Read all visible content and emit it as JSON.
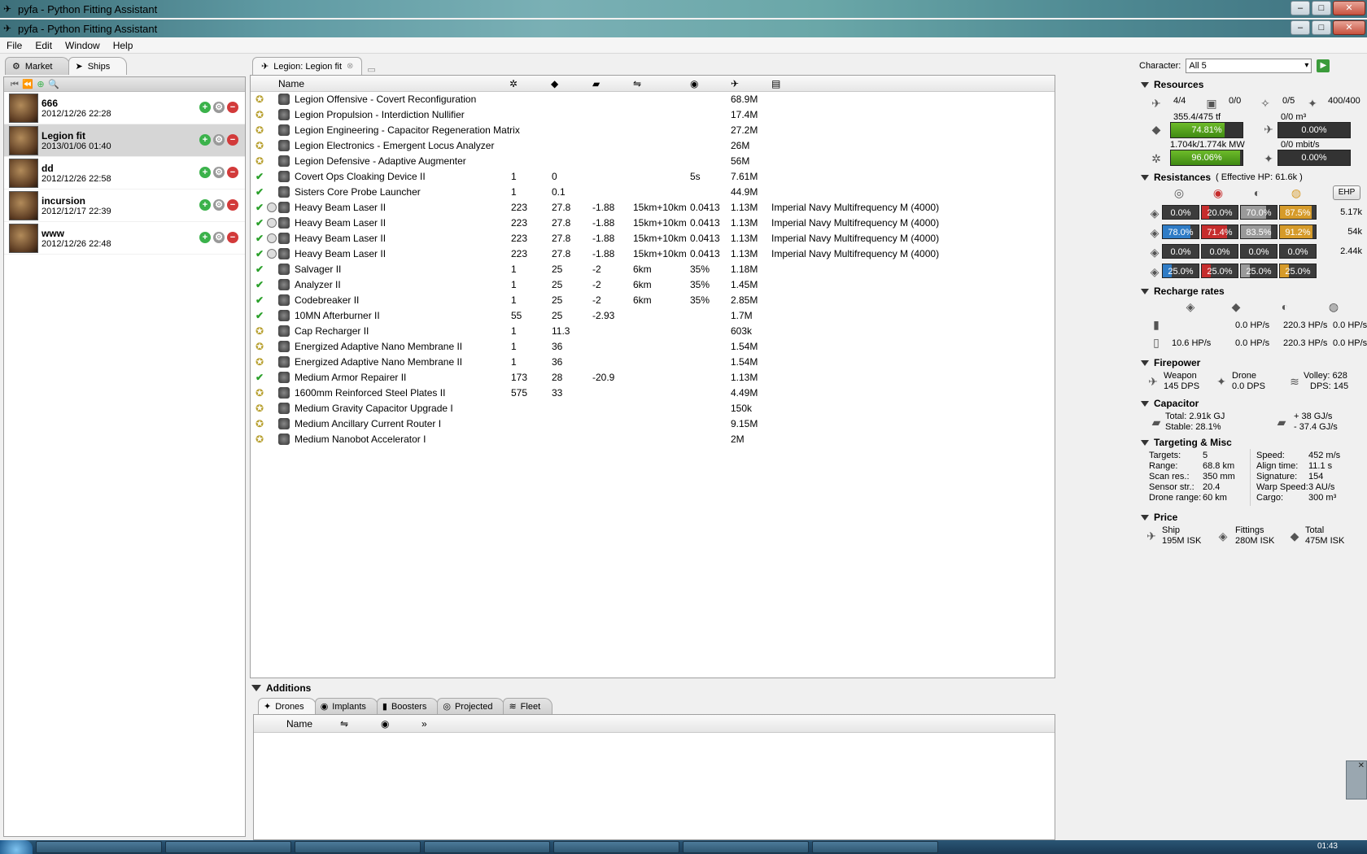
{
  "window": {
    "title": "pyfa - Python Fitting Assistant",
    "title2": "pyfa - Python Fitting Assistant"
  },
  "menu": {
    "file": "File",
    "edit": "Edit",
    "window": "Window",
    "help": "Help"
  },
  "left_tabs": {
    "market": "Market",
    "ships": "Ships"
  },
  "fits": [
    {
      "name": "666",
      "date": "2012/12/26 22:28"
    },
    {
      "name": "Legion fit",
      "date": "2013/01/06 01:40"
    },
    {
      "name": "dd",
      "date": "2012/12/26 22:58"
    },
    {
      "name": "incursion",
      "date": "2012/12/17 22:39"
    },
    {
      "name": "www",
      "date": "2012/12/26 22:48"
    }
  ],
  "center_tab": {
    "label": "Legion: Legion fit"
  },
  "fitting": {
    "name_header": "Name",
    "rows": [
      {
        "state": "off",
        "name": "Legion Offensive - Covert Reconfiguration",
        "c1": "",
        "c2": "",
        "c3": "",
        "c4": "",
        "c5": "",
        "price": "68.9M",
        "charge": ""
      },
      {
        "state": "off",
        "name": "Legion Propulsion - Interdiction Nullifier",
        "c1": "",
        "c2": "",
        "c3": "",
        "c4": "",
        "c5": "",
        "price": "17.4M",
        "charge": ""
      },
      {
        "state": "off",
        "name": "Legion Engineering - Capacitor Regeneration Matrix",
        "c1": "",
        "c2": "",
        "c3": "",
        "c4": "",
        "c5": "",
        "price": "27.2M",
        "charge": ""
      },
      {
        "state": "off",
        "name": "Legion Electronics - Emergent Locus Analyzer",
        "c1": "",
        "c2": "",
        "c3": "",
        "c4": "",
        "c5": "",
        "price": "26M",
        "charge": ""
      },
      {
        "state": "off",
        "name": "Legion Defensive - Adaptive Augmenter",
        "c1": "",
        "c2": "",
        "c3": "",
        "c4": "",
        "c5": "",
        "price": "56M",
        "charge": ""
      },
      {
        "state": "on",
        "name": "Covert Ops Cloaking Device II",
        "c1": "1",
        "c2": "0",
        "c3": "",
        "c4": "",
        "c5": "5s",
        "price": "7.61M",
        "charge": ""
      },
      {
        "state": "on",
        "name": "Sisters Core Probe Launcher",
        "c1": "1",
        "c2": "0.1",
        "c3": "",
        "c4": "",
        "c5": "",
        "price": "44.9M",
        "charge": ""
      },
      {
        "state": "on",
        "name": "Heavy Beam Laser II",
        "c1": "223",
        "c2": "27.8",
        "c3": "-1.88",
        "c4": "15km+10km",
        "c5": "0.0413",
        "price": "1.13M",
        "charge": "Imperial Navy Multifrequency M (4000)",
        "linked": true
      },
      {
        "state": "on",
        "name": "Heavy Beam Laser II",
        "c1": "223",
        "c2": "27.8",
        "c3": "-1.88",
        "c4": "15km+10km",
        "c5": "0.0413",
        "price": "1.13M",
        "charge": "Imperial Navy Multifrequency M (4000)",
        "linked": true
      },
      {
        "state": "on",
        "name": "Heavy Beam Laser II",
        "c1": "223",
        "c2": "27.8",
        "c3": "-1.88",
        "c4": "15km+10km",
        "c5": "0.0413",
        "price": "1.13M",
        "charge": "Imperial Navy Multifrequency M (4000)",
        "linked": true
      },
      {
        "state": "on",
        "name": "Heavy Beam Laser II",
        "c1": "223",
        "c2": "27.8",
        "c3": "-1.88",
        "c4": "15km+10km",
        "c5": "0.0413",
        "price": "1.13M",
        "charge": "Imperial Navy Multifrequency M (4000)",
        "linked": true
      },
      {
        "state": "on",
        "name": "Salvager II",
        "c1": "1",
        "c2": "25",
        "c3": "-2",
        "c4": "6km",
        "c5": "35%",
        "price": "1.18M",
        "charge": ""
      },
      {
        "state": "on",
        "name": "Analyzer II",
        "c1": "1",
        "c2": "25",
        "c3": "-2",
        "c4": "6km",
        "c5": "35%",
        "price": "1.45M",
        "charge": ""
      },
      {
        "state": "on",
        "name": "Codebreaker II",
        "c1": "1",
        "c2": "25",
        "c3": "-2",
        "c4": "6km",
        "c5": "35%",
        "price": "2.85M",
        "charge": ""
      },
      {
        "state": "on",
        "name": "10MN Afterburner II",
        "c1": "55",
        "c2": "25",
        "c3": "-2.93",
        "c4": "",
        "c5": "",
        "price": "1.7M",
        "charge": ""
      },
      {
        "state": "off",
        "name": "Cap Recharger II",
        "c1": "1",
        "c2": "11.3",
        "c3": "",
        "c4": "",
        "c5": "",
        "price": "603k",
        "charge": ""
      },
      {
        "state": "off",
        "name": "Energized Adaptive Nano Membrane II",
        "c1": "1",
        "c2": "36",
        "c3": "",
        "c4": "",
        "c5": "",
        "price": "1.54M",
        "charge": ""
      },
      {
        "state": "off",
        "name": "Energized Adaptive Nano Membrane II",
        "c1": "1",
        "c2": "36",
        "c3": "",
        "c4": "",
        "c5": "",
        "price": "1.54M",
        "charge": ""
      },
      {
        "state": "on",
        "name": "Medium Armor Repairer II",
        "c1": "173",
        "c2": "28",
        "c3": "-20.9",
        "c4": "",
        "c5": "",
        "price": "1.13M",
        "charge": ""
      },
      {
        "state": "off",
        "name": "1600mm Reinforced Steel Plates II",
        "c1": "575",
        "c2": "33",
        "c3": "",
        "c4": "",
        "c5": "",
        "price": "4.49M",
        "charge": ""
      },
      {
        "state": "off",
        "name": "Medium Gravity Capacitor Upgrade I",
        "c1": "",
        "c2": "",
        "c3": "",
        "c4": "",
        "c5": "",
        "price": "150k",
        "charge": ""
      },
      {
        "state": "off",
        "name": "Medium Ancillary Current Router I",
        "c1": "",
        "c2": "",
        "c3": "",
        "c4": "",
        "c5": "",
        "price": "9.15M",
        "charge": ""
      },
      {
        "state": "off",
        "name": "Medium Nanobot Accelerator I",
        "c1": "",
        "c2": "",
        "c3": "",
        "c4": "",
        "c5": "",
        "price": "2M",
        "charge": ""
      }
    ]
  },
  "additions": {
    "title": "Additions",
    "tabs": [
      "Drones",
      "Implants",
      "Boosters",
      "Projected",
      "Fleet"
    ],
    "name_header": "Name"
  },
  "character": {
    "label": "Character:",
    "value": "All 5"
  },
  "resources": {
    "title": "Resources",
    "turrets": "4/4",
    "launchers": "0/0",
    "calibration": "0/5",
    "drone_bay": "400/400",
    "cpu_text": "355.4/475 tf",
    "cpu_pct": "74.81%",
    "cpu_fill": 74.81,
    "drone_bay_text": "0/0 m³",
    "drone_pct": "0.00%",
    "power_text": "1.704k/1.774k MW",
    "power_pct": "96.06%",
    "power_fill": 96.06,
    "bandwidth_text": "0/0 mbit/s",
    "bandwidth_pct": "0.00%"
  },
  "resistances": {
    "title": "Resistances",
    "ehp": "( Effective HP: 61.6k )",
    "ehp_button": "EHP",
    "rows": [
      {
        "vals": [
          "0.0%",
          "20.0%",
          "70.0%",
          "87.5%"
        ],
        "fills": [
          0,
          20,
          70,
          87.5
        ],
        "hp": "5.17k"
      },
      {
        "vals": [
          "78.0%",
          "71.4%",
          "83.5%",
          "91.2%"
        ],
        "fills": [
          78,
          71.4,
          83.5,
          91.2
        ],
        "hp": "54k"
      },
      {
        "vals": [
          "0.0%",
          "0.0%",
          "0.0%",
          "0.0%"
        ],
        "fills": [
          0,
          0,
          0,
          0
        ],
        "hp": "2.44k"
      },
      {
        "vals": [
          "25.0%",
          "25.0%",
          "25.0%",
          "25.0%"
        ],
        "fills": [
          25,
          25,
          25,
          25
        ],
        "hp": ""
      }
    ],
    "colors": [
      "#2f7cc6",
      "#c62d2d",
      "#9a9a9a",
      "#d69b2a"
    ]
  },
  "recharge": {
    "title": "Recharge rates",
    "row1": [
      "0.0 HP/s",
      "220.3 HP/s",
      "0.0 HP/s"
    ],
    "row2": [
      "10.6 HP/s",
      "0.0 HP/s",
      "220.3 HP/s",
      "0.0 HP/s"
    ]
  },
  "firepower": {
    "title": "Firepower",
    "weapon_label": "Weapon",
    "weapon_dps": "145 DPS",
    "drone_label": "Drone",
    "drone_dps": "0.0 DPS",
    "volley": "Volley: 628",
    "dps": "DPS: 145"
  },
  "capacitor": {
    "title": "Capacitor",
    "total": "Total: 2.91k GJ",
    "stable": "Stable: 28.1%",
    "plus": "+  38  GJ/s",
    "minus": "-  37.4 GJ/s"
  },
  "targeting": {
    "title": "Targeting & Misc",
    "left": [
      [
        "Targets:",
        "5"
      ],
      [
        "Range:",
        "68.8 km"
      ],
      [
        "Scan res.:",
        "350 mm"
      ],
      [
        "Sensor str.:",
        "20.4"
      ],
      [
        "Drone range:",
        "60 km"
      ]
    ],
    "right": [
      [
        "Speed:",
        "452 m/s"
      ],
      [
        "Align time:",
        "11.1 s"
      ],
      [
        "Signature:",
        "154"
      ],
      [
        "Warp Speed:",
        "3 AU/s"
      ],
      [
        "Cargo:",
        "300 m³"
      ]
    ]
  },
  "price": {
    "title": "Price",
    "ship_label": "Ship",
    "ship": "195M ISK",
    "fittings_label": "Fittings",
    "fittings": "280M ISK",
    "total_label": "Total",
    "total": "475M ISK"
  },
  "taskbar": {
    "clock": "01:43"
  }
}
